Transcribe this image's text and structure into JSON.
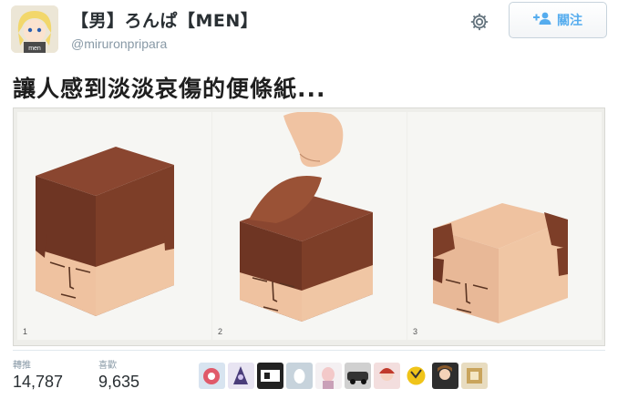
{
  "user": {
    "display_name": "【男】ろんぱ【MEN】",
    "username": "@miruronpripara",
    "avatar_label": "men"
  },
  "actions": {
    "settings_icon": "gear-icon",
    "follow_icon": "add-user-icon",
    "follow_label": "關注"
  },
  "tweet": {
    "text": "讓人感到淡淡哀傷的便條紙..."
  },
  "media": {
    "panels": [
      {
        "number": "1"
      },
      {
        "number": "2"
      },
      {
        "number": "3"
      }
    ]
  },
  "stats": {
    "retweets_label": "轉推",
    "retweets_value": "14,787",
    "likes_label": "喜歡",
    "likes_value": "9,635"
  },
  "colors": {
    "accent": "#55acee",
    "muted": "#8899a6",
    "hair": "#7a3b25",
    "skin": "#f0c6a4"
  }
}
